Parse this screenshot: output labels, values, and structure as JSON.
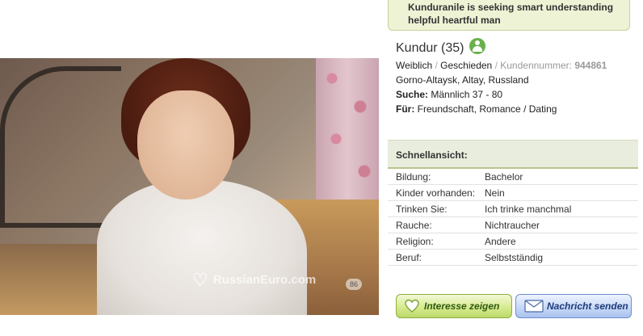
{
  "headline": "Kunduranile is seeking smart understanding helpful heartful man",
  "profile": {
    "name": "Kundur (35)",
    "gender": "Weiblich",
    "separator": "/",
    "marital_status": "Geschieden",
    "customer_number_label": "Kundennummer:",
    "customer_number": "944861",
    "location": "Gorno-Altaysk, Altay, Russland",
    "search_label": "Suche:",
    "search_value": "Männlich 37 - 80",
    "for_label": "Für:",
    "for_value": "Freundschaft, Romance / Dating"
  },
  "photo": {
    "watermark": "RussianEuro.com",
    "counter": "86"
  },
  "quickview": {
    "title": "Schnellansicht:",
    "rows": [
      {
        "label": "Bildung:",
        "value": "Bachelor"
      },
      {
        "label": "Kinder vorhanden:",
        "value": "Nein"
      },
      {
        "label": "Trinken Sie:",
        "value": "Ich trinke manchmal"
      },
      {
        "label": "Rauche:",
        "value": "Nichtraucher"
      },
      {
        "label": "Religion:",
        "value": "Andere"
      },
      {
        "label": "Beruf:",
        "value": "Selbstständig"
      }
    ]
  },
  "buttons": {
    "interest": "Interesse zeigen",
    "message": "Nachricht senden"
  },
  "icons": {
    "online": "online-user-icon",
    "interest": "heart-icon",
    "message": "envelope-icon"
  },
  "colors": {
    "interest_button": "#d7eb8f",
    "message_button": "#c8d9f7",
    "online_status": "#6ab04c",
    "bubble": "#eef3d6"
  }
}
